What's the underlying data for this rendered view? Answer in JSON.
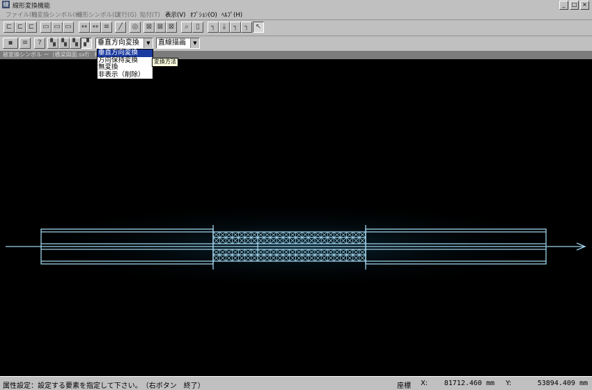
{
  "window": {
    "title": "線形変換機能",
    "minimize": "_",
    "maximize": "□",
    "close": "×"
  },
  "menu": [
    {
      "label": "ファイル(F)",
      "enabled": false
    },
    {
      "label": "被変換シンボル(H)",
      "enabled": false
    },
    {
      "label": "線形シンボル(L)",
      "enabled": false
    },
    {
      "label": "実行(G)",
      "enabled": false
    },
    {
      "label": "貼付(T)",
      "enabled": false
    },
    {
      "label": "表示(V)",
      "enabled": true
    },
    {
      "label": "ｵﾌﾟｼｮﾝ(O)",
      "enabled": true
    },
    {
      "label": "ﾍﾙﾌﾟ(H)",
      "enabled": true
    }
  ],
  "toolbar2": {
    "transform_select": {
      "value": "垂直方向変換"
    },
    "draw_select": {
      "value": "直線描画"
    }
  },
  "dropdown": {
    "options": [
      "垂直方向変換",
      "方向保持変換",
      "無変換",
      "非表示（削除）"
    ],
    "selected_index": 0
  },
  "tooltip": "変換方法",
  "pathbar": "被変換シンボル ー〔橋梁図面.sxf〕 相手",
  "status": {
    "message": "属性設定：設定する要素を指定して下さい。　（右ボタン　終了）",
    "coord_label": "座標",
    "x_label": "X:",
    "x_value": "81712.460 mm",
    "y_label": "Y:",
    "y_value": "53894.409 mm"
  },
  "colors": {
    "canvas_bg": "#000000",
    "drawing_line": "#9fd4ec",
    "selection": "#1a3aa0"
  }
}
